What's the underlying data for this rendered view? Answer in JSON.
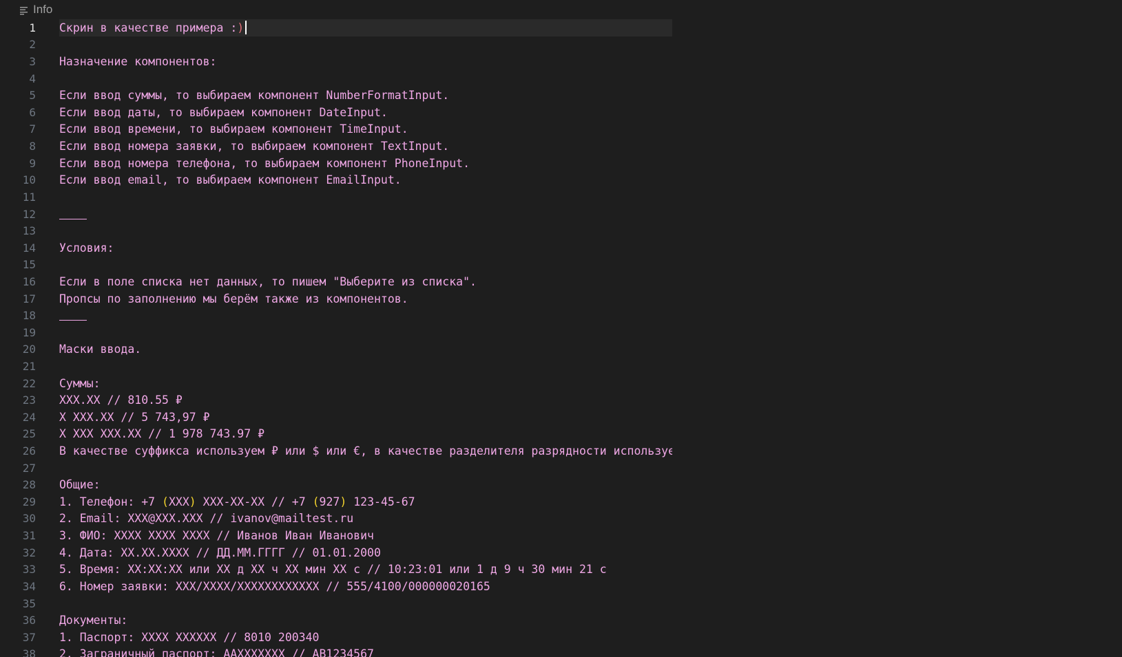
{
  "breadcrumb": {
    "icon": "list-lines-icon",
    "label": "Info"
  },
  "editor": {
    "current_line": 1,
    "lines": [
      {
        "n": "1",
        "text": "Скрин в качестве примера :",
        "smile": ")"
      },
      {
        "n": "2",
        "text": ""
      },
      {
        "n": "3",
        "text": "Назначение компонентов:"
      },
      {
        "n": "4",
        "text": ""
      },
      {
        "n": "5",
        "text": "Если ввод суммы, то выбираем компонент NumberFormatInput."
      },
      {
        "n": "6",
        "text": "Если ввод даты, то выбираем компонент DateInput."
      },
      {
        "n": "7",
        "text": "Если ввод времени, то выбираем компонент TimeInput."
      },
      {
        "n": "8",
        "text": "Если ввод номера заявки, то выбираем компонент TextInput."
      },
      {
        "n": "9",
        "text": "Если ввод номера телефона, то выбираем компонент PhoneInput."
      },
      {
        "n": "10",
        "text": "Если ввод email, то выбираем компонент EmailInput."
      },
      {
        "n": "11",
        "text": ""
      },
      {
        "n": "12",
        "rule": true
      },
      {
        "n": "13",
        "text": ""
      },
      {
        "n": "14",
        "text": "Условия:"
      },
      {
        "n": "15",
        "text": ""
      },
      {
        "n": "16",
        "text": "Если в поле списка нет данных, то пишем \"Выберите из списка\"."
      },
      {
        "n": "17",
        "text": "Пропсы по заполнению мы берём также из компонентов."
      },
      {
        "n": "18",
        "rule": true
      },
      {
        "n": "19",
        "text": ""
      },
      {
        "n": "20",
        "text": "Маски ввода."
      },
      {
        "n": "21",
        "text": ""
      },
      {
        "n": "22",
        "text": "Суммы:"
      },
      {
        "n": "23",
        "text": "XXX.XX // 810.55 ₽"
      },
      {
        "n": "24",
        "text": "X XXX.XX // 5 743,97 ₽"
      },
      {
        "n": "25",
        "text": "X XXX XXX.XX // 1 978 743.97 ₽"
      },
      {
        "n": "26",
        "text": "В качестве суффикса используем ₽ или $ или €, в качестве разделителя разрядности используе"
      },
      {
        "n": "27",
        "text": ""
      },
      {
        "n": "28",
        "text": "Общие:"
      },
      {
        "n": "29",
        "parts": [
          {
            "t": "1. Телефон: +7 "
          },
          {
            "t": "(",
            "c": "paren"
          },
          {
            "t": "XXX"
          },
          {
            "t": ")",
            "c": "paren"
          },
          {
            "t": " XXX-XX-XX // +7 "
          },
          {
            "t": "(",
            "c": "paren"
          },
          {
            "t": "927"
          },
          {
            "t": ")",
            "c": "paren"
          },
          {
            "t": " 123-45-67"
          }
        ]
      },
      {
        "n": "30",
        "text": "2. Email: XXX@XXX.XXX // ivanov@mailtest.ru"
      },
      {
        "n": "31",
        "text": "3. ФИО: XXXX XXXX XXXX // Иванов Иван Иванович"
      },
      {
        "n": "32",
        "text": "4. Дата: XX.XX.XXXX // ДД.ММ.ГГГГ // 01.01.2000"
      },
      {
        "n": "33",
        "text": "5. Время: XX:XX:XX или XX д XX ч XX мин XX с // 10:23:01 или 1 д 9 ч 30 мин 21 с"
      },
      {
        "n": "34",
        "text": "6. Номер заявки: XXX/XXXX/XXXXXXXXXXXX // 555/4100/000000020165"
      },
      {
        "n": "35",
        "text": ""
      },
      {
        "n": "36",
        "text": "Документы:"
      },
      {
        "n": "37",
        "text": "1. Паспорт: XXXX XXXXXX // 8010 200340"
      },
      {
        "n": "38",
        "text": "2. Заграничный паспорт: AAXXXXXXX // AB1234567"
      }
    ]
  }
}
